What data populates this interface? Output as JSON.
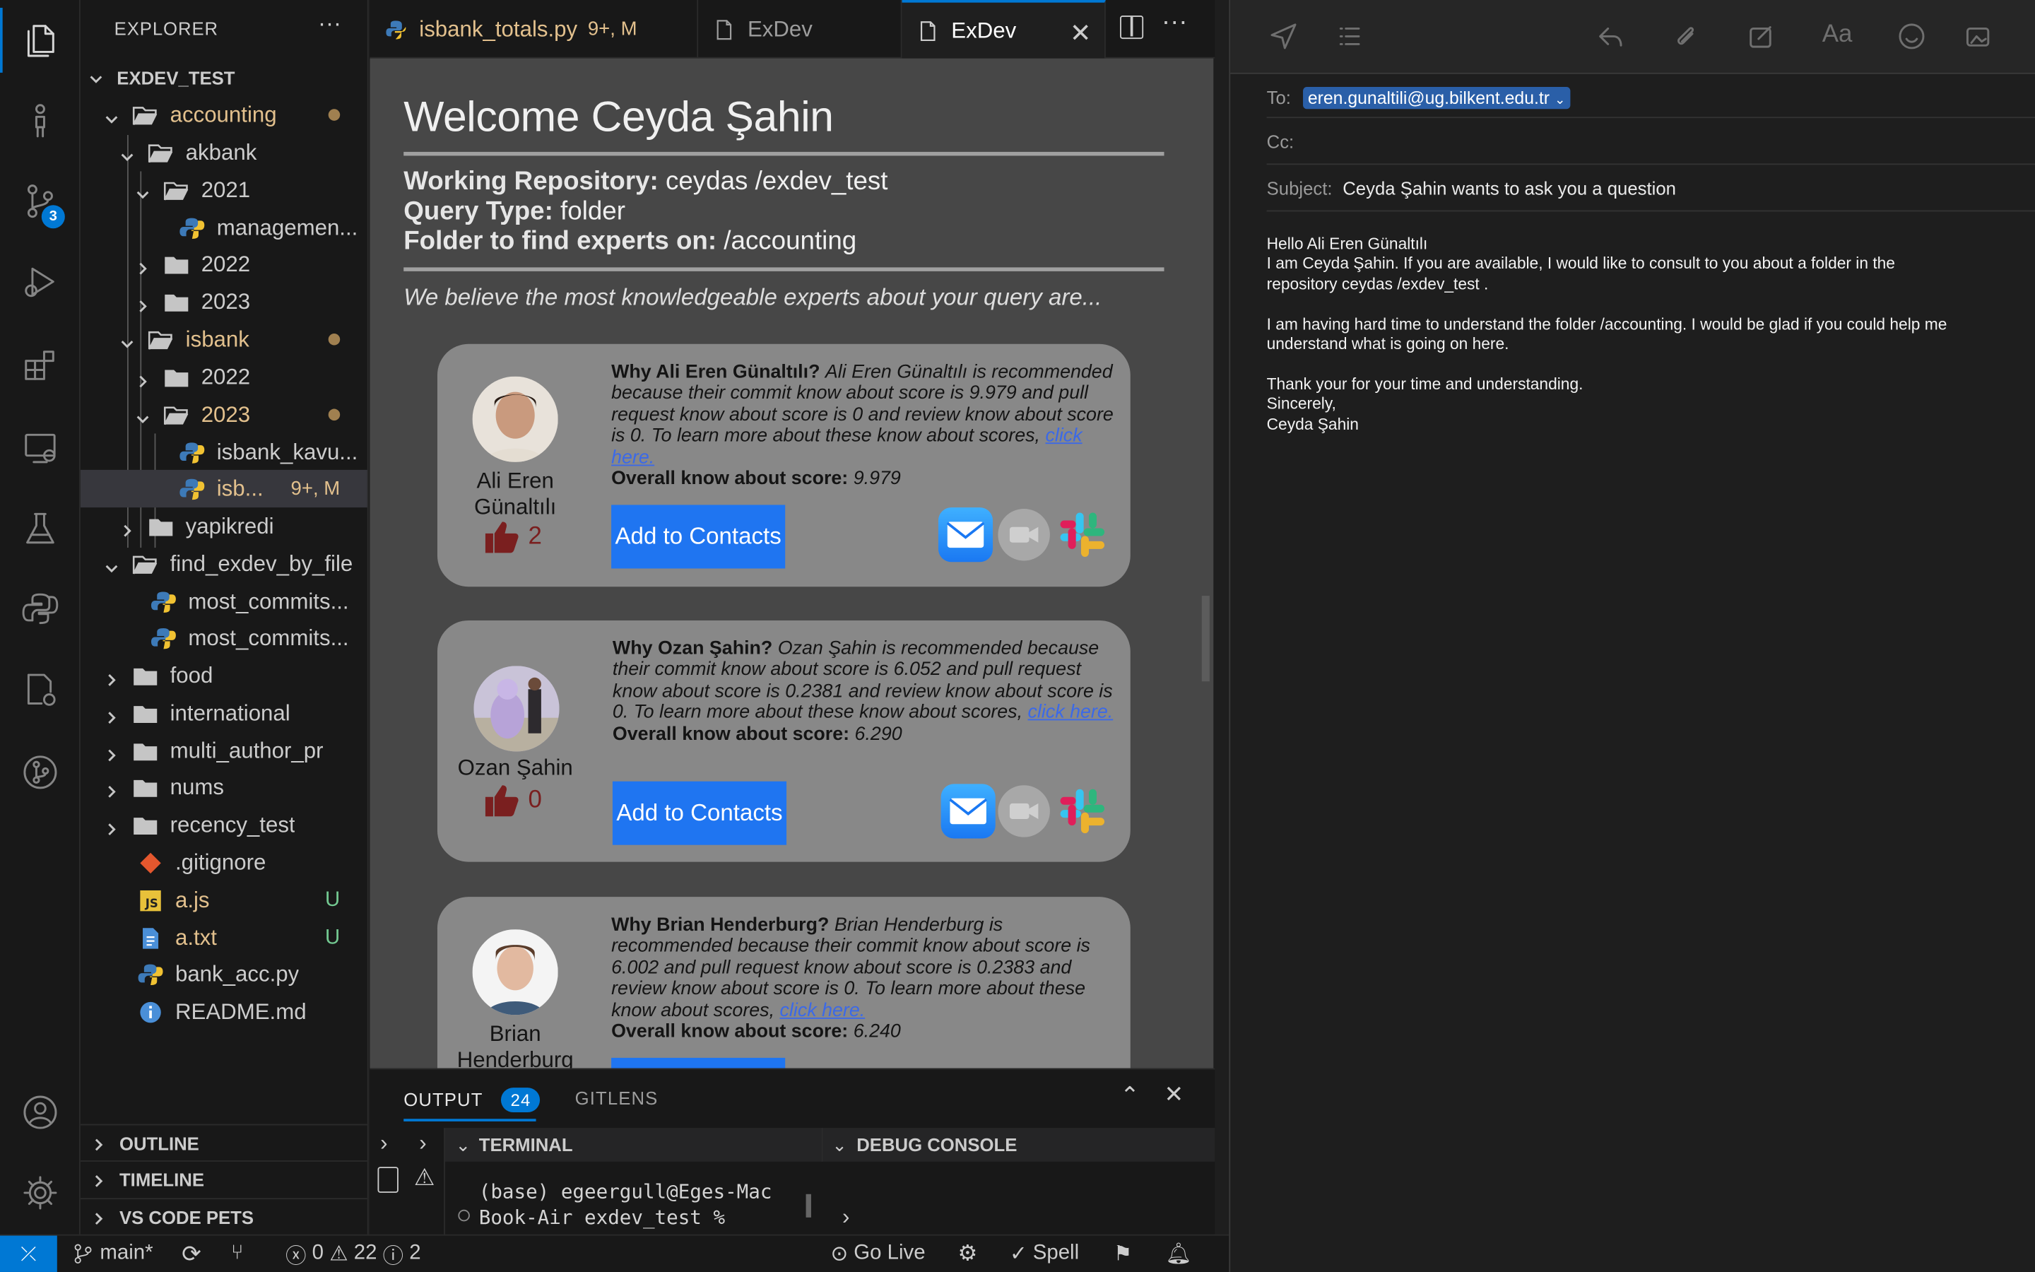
{
  "activity_bar": {
    "scm_badge": "3"
  },
  "explorer": {
    "title": "EXPLORER",
    "root": "EXDEV_TEST",
    "items": [
      {
        "label": "accounting"
      },
      {
        "label": "akbank"
      },
      {
        "label": "2021"
      },
      {
        "label": "managemen..."
      },
      {
        "label": "2022"
      },
      {
        "label": "2023"
      },
      {
        "label": "isbank"
      },
      {
        "label": "2022"
      },
      {
        "label": "2023"
      },
      {
        "label": "isbank_kavu..."
      },
      {
        "label": "isb...",
        "decoration": "9+, M"
      },
      {
        "label": "yapikredi"
      },
      {
        "label": "find_exdev_by_file"
      },
      {
        "label": "most_commits..."
      },
      {
        "label": "most_commits..."
      },
      {
        "label": "food"
      },
      {
        "label": "international"
      },
      {
        "label": "multi_author_pr"
      },
      {
        "label": "nums"
      },
      {
        "label": "recency_test"
      },
      {
        "label": ".gitignore"
      },
      {
        "label": "a.js",
        "decoration": "U"
      },
      {
        "label": "a.txt",
        "decoration": "U"
      },
      {
        "label": "bank_acc.py"
      },
      {
        "label": "README.md"
      }
    ],
    "sections": [
      "OUTLINE",
      "TIMELINE",
      "VS CODE PETS"
    ]
  },
  "tabs": [
    {
      "label": "isbank_totals.py",
      "decoration": "9+, M"
    },
    {
      "label": "ExDev"
    },
    {
      "label": "ExDev"
    }
  ],
  "webview": {
    "title": "Welcome Ceyda Şahin",
    "repo_label": "Working Repository:",
    "repo_value": "ceydas /exdev_test",
    "query_label": "Query Type:",
    "query_value": "folder",
    "folder_label": "Folder to find experts on:",
    "folder_value": "/accounting",
    "lead": "We believe the most knowledgeable experts about your query are...",
    "add_contacts": "Add to Contacts",
    "link_text": "click here.",
    "overall_label": "Overall know about score:",
    "experts": [
      {
        "name_line1": "Ali Eren",
        "name_line2": "Günaltılı",
        "votes": "2",
        "why_label": "Why Ali Eren Günaltılı?",
        "why_text": "Ali Eren Günaltılı is recommended because their commit know about score is 9.979 and pull request know about score is 0 and review know about score is 0. To learn more about these know about scores,",
        "overall": "9.979"
      },
      {
        "name_line1": "Ozan Şahin",
        "name_line2": "",
        "votes": "0",
        "why_label": "Why Ozan Şahin?",
        "why_text": "Ozan Şahin is recommended because their commit know about score is 6.052 and pull request know about score is 0.2381 and review know about score is 0. To learn more about these know about scores,",
        "overall": "6.290"
      },
      {
        "name_line1": "Brian",
        "name_line2": "Henderburg",
        "votes": "",
        "why_label": "Why Brian Henderburg?",
        "why_text": "Brian Henderburg is recommended because their commit know about score is 6.002 and pull request know about score is 0.2383 and review know about score is 0. To learn more about these know about scores,",
        "overall": "6.240"
      }
    ]
  },
  "panel": {
    "output_label": "OUTPUT",
    "output_count": "24",
    "gitlens_label": "GITLENS",
    "terminal_label": "TERMINAL",
    "debug_label": "DEBUG CONSOLE",
    "terminal_line1": "(base) egeergull@Eges-Mac",
    "terminal_line2": "Book-Air exdev_test %"
  },
  "status_bar": {
    "branch": "main*",
    "errors": "0",
    "warnings": "22",
    "infos": "2",
    "go_live": "Go Live",
    "spell": "Spell"
  },
  "mail": {
    "to_label": "To:",
    "to_value": "eren.gunaltili@ug.bilkent.edu.tr",
    "cc_label": "Cc:",
    "subject_label": "Subject:",
    "subject_value": "Ceyda Şahin wants to ask you a question",
    "body": [
      "Hello Ali Eren Günaltılı",
      "I am Ceyda Şahin. If you are available, I would like to consult to you about a folder in the",
      "repository ceydas /exdev_test .",
      "",
      "I am having hard time to understand the folder /accounting. I would be glad if you could help me",
      "understand what is going on here.",
      "",
      "Thank your for your time and understanding.",
      "Sincerely,",
      "Ceyda Şahin"
    ]
  }
}
